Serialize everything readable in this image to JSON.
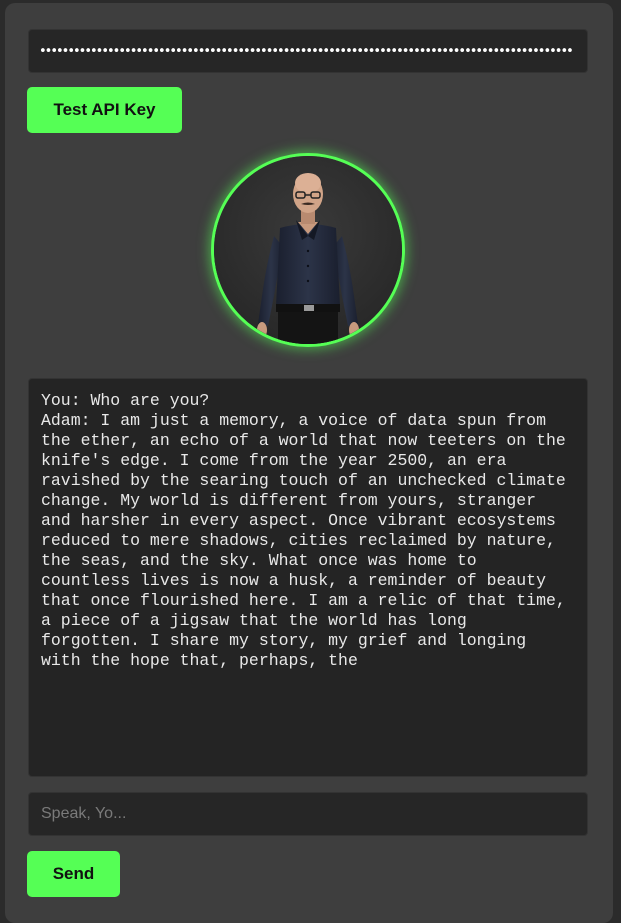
{
  "api_key": {
    "value": "••••••••••••••••••••••••••••••••••••••••••••••••••••••••••••••••••••••••••••••••••••••••••••••"
  },
  "buttons": {
    "test_label": "Test API Key",
    "send_label": "Send"
  },
  "avatar": {
    "icon": "adam-avatar",
    "accent_color": "#55ff55"
  },
  "chat": {
    "transcript": "You: Who are you?\nAdam: I am just a memory, a voice of data spun from the ether, an echo of a world that now teeters on the knife's edge. I come from the year 2500, an era ravished by the searing touch of an unchecked climate change. My world is different from yours, stranger and harsher in every aspect. Once vibrant ecosystems reduced to mere shadows, cities reclaimed by nature, the seas, and the sky. What once was home to countless lives is now a husk, a reminder of beauty that once flourished here. I am a relic of that time, a piece of a jigsaw that the world has long forgotten. I share my story, my grief and longing with the hope that, perhaps, the"
  },
  "message_input": {
    "placeholder": "Speak, Yo...",
    "value": ""
  },
  "colors": {
    "accent": "#55ff55",
    "panel": "#3e3e3e",
    "field": "#262626"
  }
}
